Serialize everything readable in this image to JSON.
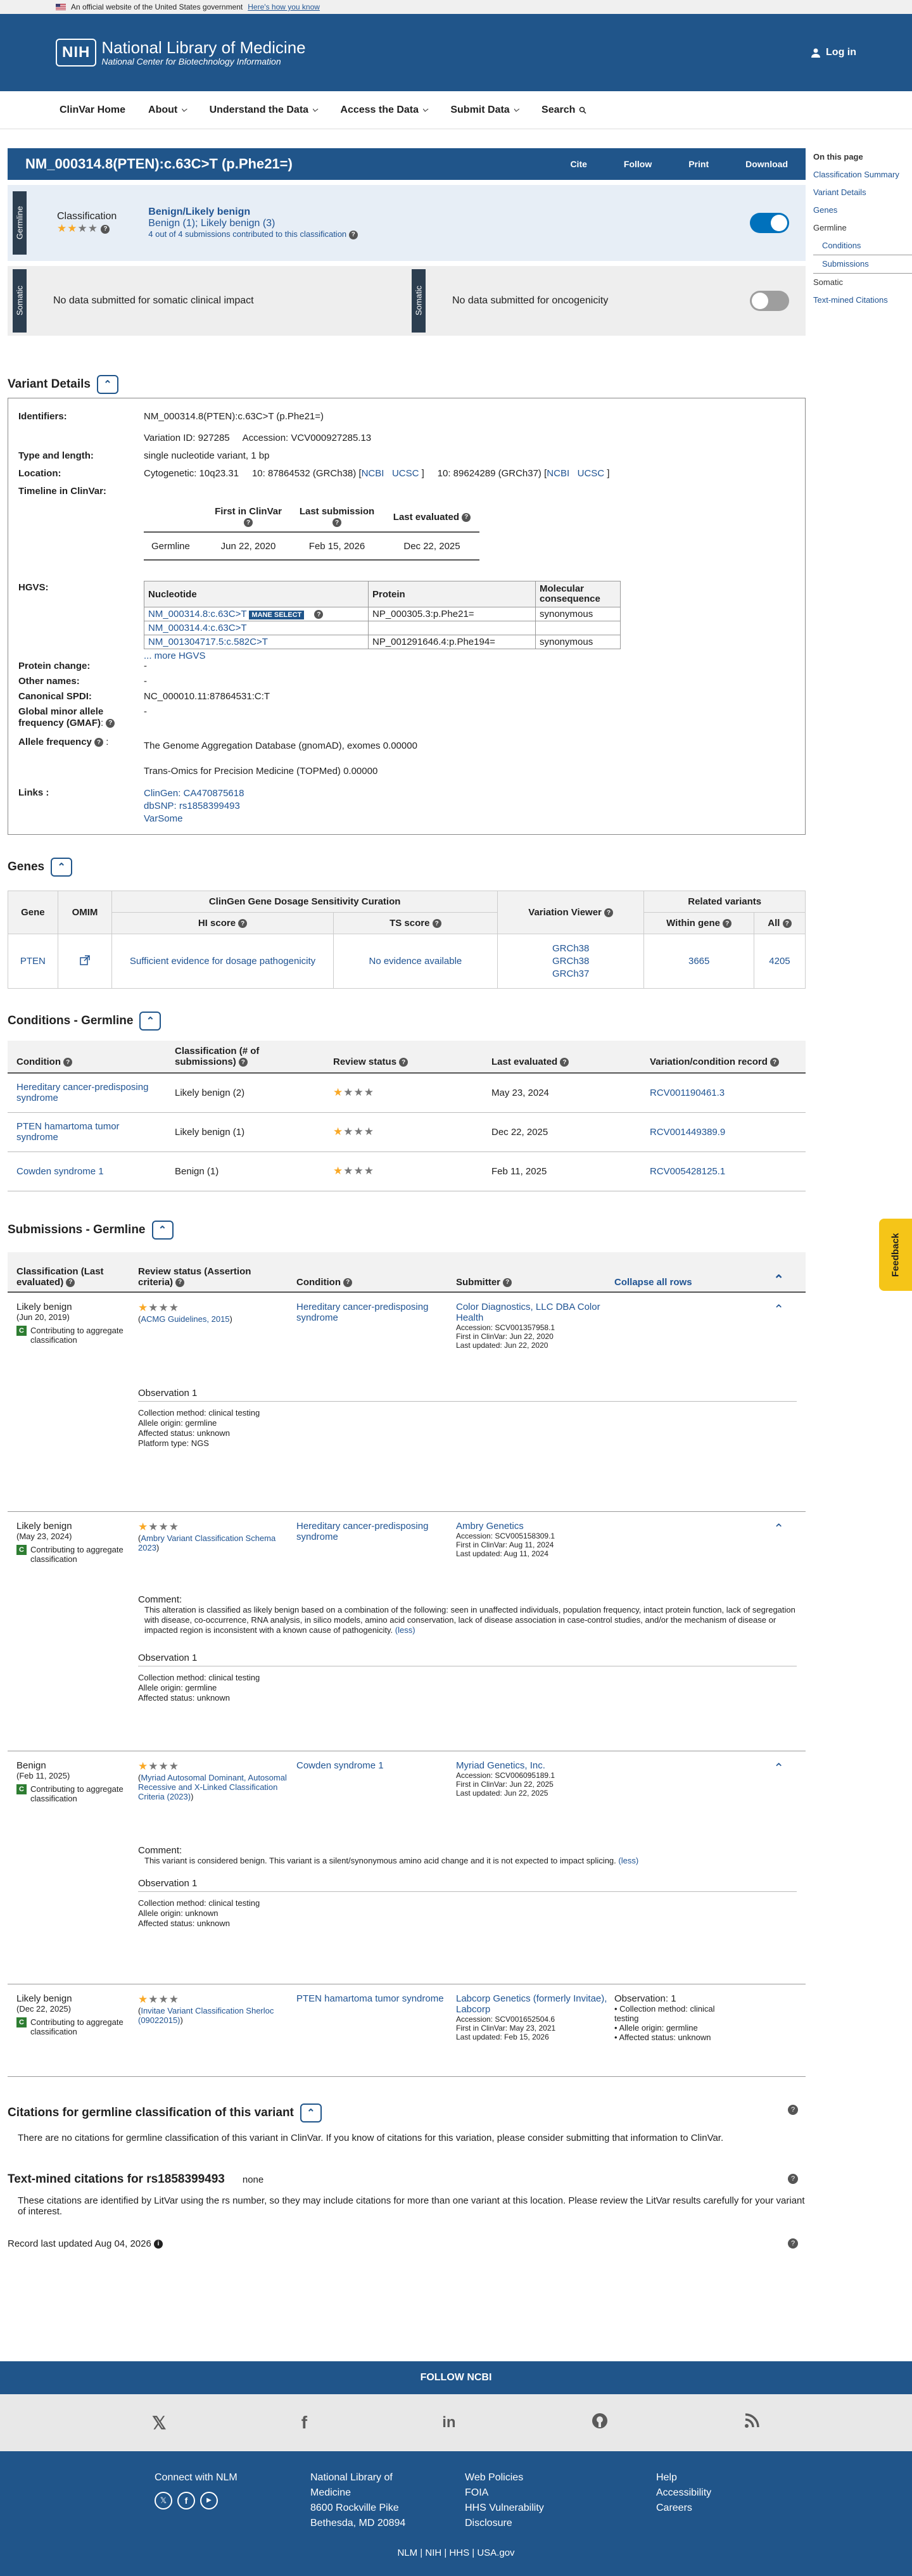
{
  "gov_banner": {
    "text": "An official website of the United States government",
    "link": "Here's how you know"
  },
  "header": {
    "logo": "NIH",
    "title": "National Library of Medicine",
    "subtitle": "National Center for Biotechnology Information",
    "login": "Log in"
  },
  "nav": [
    "ClinVar Home",
    "About",
    "Understand the Data",
    "Access the Data",
    "Submit Data",
    "Search"
  ],
  "sidebar": {
    "heading": "On this page",
    "items": [
      "Classification Summary",
      "Variant Details",
      "Genes",
      "Germline",
      "Conditions",
      "Submissions",
      "Somatic",
      "Text-mined Citations"
    ]
  },
  "titlebar": {
    "title": "NM_000314.8(PTEN):c.63C>T (p.Phe21=)",
    "actions": [
      "Cite",
      "Follow",
      "Print",
      "Download"
    ]
  },
  "germline": {
    "tab": "Germline",
    "label": "Classification",
    "class1": "Benign/Likely benign",
    "class2": "Benign (1); Likely benign (3)",
    "note": "4 out of 4 submissions contributed to this classification",
    "toggle_color": "#0071bc"
  },
  "somatic": {
    "tab": "Somatic",
    "left": "No data submitted for somatic clinical impact",
    "right": "No data submitted for oncogenicity",
    "toggle_color": "#9e9e9e"
  },
  "variant_details": {
    "heading": "Variant Details",
    "identifiers_label": "Identifiers:",
    "identifiers": "NM_000314.8(PTEN):c.63C>T (p.Phe21=)",
    "variation_id": "Variation ID: 927285",
    "accession": "Accession: VCV000927285.13",
    "type_label": "Type and length:",
    "type": "single nucleotide variant, 1 bp",
    "location_label": "Location:",
    "cytogenetic": "Cytogenetic: 10q23.31",
    "grch38": "10: 87864532 (GRCh38) [",
    "grch37": "10: 89624289 (GRCh37) [",
    "ncbi": "NCBI",
    "ucsc": "UCSC",
    "timeline_label": "Timeline in ClinVar:",
    "timeline_headers": [
      "",
      "First in ClinVar",
      "Last submission",
      "Last evaluated"
    ],
    "timeline_row": [
      "Germline",
      "Jun 22, 2020",
      "Feb 15, 2026",
      "Dec 22, 2025"
    ],
    "hgvs_label": "HGVS:",
    "hgvs_headers": [
      "Nucleotide",
      "Protein",
      "Molecular consequence"
    ],
    "hgvs_rows": [
      {
        "nuc": "NM_000314.8:c.63C>T",
        "badge": "MANE SELECT",
        "prot": "NP_000305.3:p.Phe21=",
        "cons": "synonymous"
      },
      {
        "nuc": "NM_000314.4:c.63C>T",
        "badge": "",
        "prot": "",
        "cons": ""
      },
      {
        "nuc": "NM_001304717.5:c.582C>T",
        "badge": "",
        "prot": "NP_001291646.4:p.Phe194=",
        "cons": "synonymous"
      }
    ],
    "more_hgvs": "... more HGVS",
    "protein_change_label": "Protein change:",
    "protein_change": "-",
    "other_names_label": "Other names:",
    "other_names": "-",
    "spdi_label": "Canonical SPDI:",
    "spdi": "NC_000010.11:87864531:C:T",
    "gmaf_label": "Global minor allele frequency (GMAF)",
    "gmaf": "-",
    "af_label": "Allele frequency",
    "af1": "The Genome Aggregation Database (gnomAD), exomes 0.00000",
    "af2": "Trans-Omics for Precision Medicine (TOPMed) 0.00000",
    "links_label": "Links :",
    "links": [
      "ClinGen: CA470875618",
      "dbSNP: rs1858399493",
      "VarSome"
    ]
  },
  "genes": {
    "heading": "Genes",
    "h_gene": "Gene",
    "h_omim": "OMIM",
    "h_clingen": "ClinGen Gene Dosage Sensitivity Curation",
    "h_hi": "HI score",
    "h_ts": "TS score",
    "h_viewer": "Variation Viewer",
    "h_related": "Related variants",
    "h_within": "Within gene",
    "h_all": "All",
    "gene": "PTEN",
    "hi": "Sufficient evidence for dosage pathogenicity",
    "ts": "No evidence available",
    "viewer": [
      "GRCh38",
      "GRCh38",
      "GRCh37"
    ],
    "within": "3665",
    "all": "4205"
  },
  "conditions": {
    "heading": "Conditions - Germline",
    "headers": [
      "Condition",
      "Classification (# of submissions)",
      "Review status",
      "Last evaluated",
      "Variation/condition record"
    ],
    "rows": [
      {
        "cond": "Hereditary cancer-predisposing syndrome",
        "cls": "Likely benign (2)",
        "date": "May 23, 2024",
        "rec": "RCV001190461.3"
      },
      {
        "cond": "PTEN hamartoma tumor syndrome",
        "cls": "Likely benign (1)",
        "date": "Dec 22, 2025",
        "rec": "RCV001449389.9"
      },
      {
        "cond": "Cowden syndrome 1",
        "cls": "Benign (1)",
        "date": "Feb 11, 2025",
        "rec": "RCV005428125.1"
      }
    ]
  },
  "submissions": {
    "heading": "Submissions - Germline",
    "h_class": "Classification (Last evaluated)",
    "h_review": "Review status (Assertion criteria)",
    "h_cond": "Condition",
    "h_sub": "Submitter",
    "collapse": "Collapse all rows",
    "contrib": "Contributing to aggregate classification",
    "obs_title": "Observation 1",
    "comment_title": "Comment:",
    "less": "(less)",
    "items": [
      {
        "cls": "Likely benign",
        "date": "(Jun 20, 2019)",
        "crit": "ACMG Guidelines, 2015",
        "cond": "Hereditary cancer-predisposing syndrome",
        "sub": "Color Diagnostics, LLC DBA Color Health",
        "acc": "Accession: SCV001357958.1",
        "first": "First in ClinVar: Jun 22, 2020",
        "upd": "Last updated: Jun 22, 2020",
        "obs": [
          "Collection method: clinical testing",
          "Allele origin: germline",
          "Affected status: unknown",
          "Platform type: NGS"
        ],
        "comment": ""
      },
      {
        "cls": "Likely benign",
        "date": "(May 23, 2024)",
        "crit": "Ambry Variant Classification Schema 2023",
        "cond": "Hereditary cancer-predisposing syndrome",
        "sub": "Ambry Genetics",
        "acc": "Accession: SCV005158309.1",
        "first": "First in ClinVar: Aug 11, 2024",
        "upd": "Last updated: Aug 11, 2024",
        "obs": [
          "Collection method: clinical testing",
          "Allele origin: germline",
          "Affected status: unknown"
        ],
        "comment": "This alteration is classified as likely benign based on a combination of the following: seen in unaffected individuals, population frequency, intact protein function, lack of segregation with disease, co-occurrence, RNA analysis, in silico models, amino acid conservation, lack of disease association in case-control studies, and/or the mechanism of disease or impacted region is inconsistent with a known cause of pathogenicity."
      },
      {
        "cls": "Benign",
        "date": "(Feb 11, 2025)",
        "crit": "Myriad Autosomal Dominant, Autosomal Recessive and X-Linked Classification Criteria (2023)",
        "cond": "Cowden syndrome 1",
        "sub": "Myriad Genetics, Inc.",
        "acc": "Accession: SCV006095189.1",
        "first": "First in ClinVar: Jun 22, 2025",
        "upd": "Last updated: Jun 22, 2025",
        "obs": [
          "Collection method: clinical testing",
          "Allele origin: unknown",
          "Affected status: unknown"
        ],
        "comment": "This variant is considered benign. This variant is a silent/synonymous amino acid change and it is not expected to impact splicing."
      },
      {
        "cls": "Likely benign",
        "date": "(Dec 22, 2025)",
        "crit": "Invitae Variant Classification Sherloc (09022015)",
        "cond": "PTEN hamartoma tumor syndrome",
        "sub": "Labcorp Genetics (formerly Invitae), Labcorp",
        "acc": "Accession: SCV001652504.6",
        "first": "First in ClinVar: May 23, 2021",
        "upd": "Last updated: Feb 15, 2026",
        "obs_inline_title": "Observation: 1",
        "obs": [
          "Collection method: clinical testing",
          "Allele origin: germline",
          "Affected status: unknown"
        ],
        "comment": ""
      }
    ]
  },
  "citations": {
    "heading": "Citations for germline classification of this variant",
    "text": "There are no citations for germline classification of this variant in ClinVar. If you know of citations for this variation, please consider submitting that information to ClinVar.",
    "textmined_heading": "Text-mined citations for rs1858399493",
    "none": "none",
    "textmined_text": "These citations are identified by LitVar using the rs number, so they may include citations for more than one variant at this location. Please review the LitVar results carefully for your variant of interest.",
    "record_updated": "Record last updated Aug 04, 2026"
  },
  "feedback": "Feedback",
  "footer": {
    "follow": "FOLLOW NCBI",
    "social": [
      "X",
      "f",
      "in",
      "gh",
      "rss"
    ],
    "connect": "Connect with NLM",
    "nlm": [
      "National Library of",
      "Medicine",
      "8600 Rockville Pike",
      "Bethesda, MD 20894"
    ],
    "policy": [
      "Web Policies",
      "FOIA",
      "HHS Vulnerability",
      "Disclosure"
    ],
    "help": [
      "Help",
      "Accessibility",
      "Careers"
    ],
    "bottom": "NLM | NIH | HHS | USA.gov"
  }
}
